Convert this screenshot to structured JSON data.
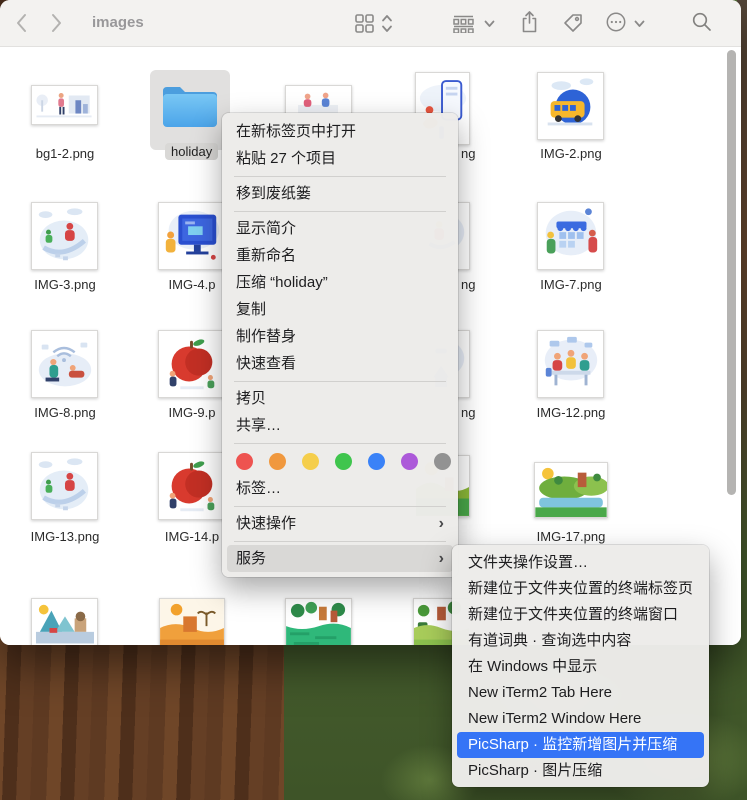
{
  "toolbar": {
    "title": "images",
    "icons": [
      "back",
      "forward",
      "view-grid",
      "group-items",
      "share",
      "tags",
      "more-actions",
      "search"
    ]
  },
  "files": [
    {
      "label": "bg1-2.png"
    },
    {
      "label": "holiday",
      "selected": true,
      "type": "folder"
    },
    {
      "label": "ng"
    },
    {
      "label": "IMG-2.png"
    },
    {
      "label": "IMG-3.png"
    },
    {
      "label": "IMG-4.p"
    },
    {
      "label": "ng"
    },
    {
      "label": "IMG-7.png"
    },
    {
      "label": "IMG-8.png"
    },
    {
      "label": "IMG-9.p"
    },
    {
      "label": "ng"
    },
    {
      "label": "IMG-12.png"
    },
    {
      "label": "IMG-13.png"
    },
    {
      "label": "IMG-14.p"
    },
    {
      "label": "IMG-17.png"
    }
  ],
  "context_menu": {
    "items": [
      {
        "label": "在新标签页中打开"
      },
      {
        "label": "粘贴 27 个项目"
      },
      {
        "type": "separator"
      },
      {
        "label": "移到废纸篓"
      },
      {
        "type": "separator"
      },
      {
        "label": "显示简介"
      },
      {
        "label": "重新命名"
      },
      {
        "label": "压缩 “holiday”"
      },
      {
        "label": "复制"
      },
      {
        "label": "制作替身"
      },
      {
        "label": "快速查看"
      },
      {
        "type": "separator"
      },
      {
        "label": "拷贝"
      },
      {
        "label": "共享…"
      },
      {
        "type": "separator"
      },
      {
        "type": "tag-colors"
      },
      {
        "label": "标签…"
      },
      {
        "type": "separator"
      },
      {
        "label": "快速操作",
        "has_submenu": true
      },
      {
        "type": "separator"
      },
      {
        "label": "服务",
        "has_submenu": true,
        "highlighted": true
      }
    ],
    "tag_colors": [
      "#ee5350",
      "#f0983e",
      "#f5ce4b",
      "#3fc54d",
      "#3a82f7",
      "#ac59d9",
      "#929292"
    ],
    "parent_highlight_color": "#d9d8d6"
  },
  "services_submenu": {
    "items": [
      {
        "label": "文件夹操作设置…"
      },
      {
        "label": "新建位于文件夹位置的终端标签页"
      },
      {
        "label": "新建位于文件夹位置的终端窗口"
      },
      {
        "label": "有道词典 · 查询选中内容"
      },
      {
        "label": "在 Windows 中显示"
      },
      {
        "label": "New iTerm2 Tab Here"
      },
      {
        "label": "New iTerm2 Window Here"
      },
      {
        "label": "PicSharp · 监控新增图片并压缩",
        "selected": true
      },
      {
        "label": "PicSharp · 图片压缩"
      }
    ],
    "selection_color": "#3574f6"
  }
}
